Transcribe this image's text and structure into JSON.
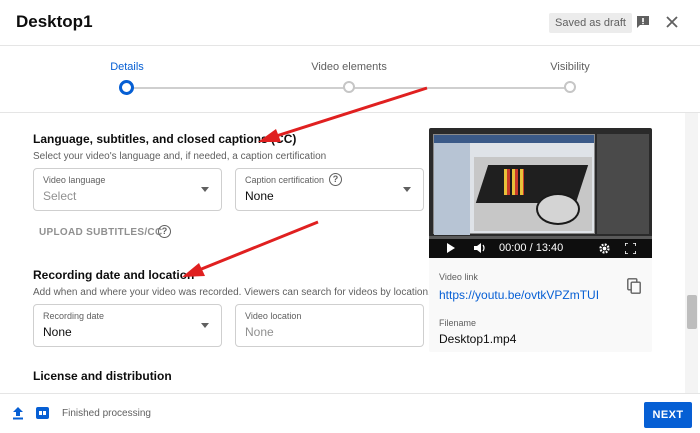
{
  "header": {
    "title": "Desktop1",
    "draft_badge": "Saved as draft"
  },
  "stepper": {
    "steps": [
      {
        "label": "Details",
        "state": "active"
      },
      {
        "label": "Video elements",
        "state": "todo"
      },
      {
        "label": "Visibility",
        "state": "todo"
      }
    ]
  },
  "captions": {
    "title": "Language, subtitles, and closed captions (CC)",
    "description": "Select your video's language and, if needed, a caption certification",
    "video_language_label": "Video language",
    "video_language_value": "Select",
    "caption_cert_label": "Caption certification",
    "caption_cert_value": "None",
    "upload_subtitles": "UPLOAD SUBTITLES/CC"
  },
  "recording": {
    "title": "Recording date and location",
    "description": "Add when and where your video was recorded. Viewers can search for videos by location.",
    "date_label": "Recording date",
    "date_value": "None",
    "location_label": "Video location",
    "location_placeholder": "None"
  },
  "license": {
    "title": "License and distribution"
  },
  "preview": {
    "time": "00:00 / 13:40",
    "video_link_label": "Video link",
    "video_link": "https://youtu.be/ovtkVPZmTUI",
    "filename_label": "Filename",
    "filename": "Desktop1.mp4"
  },
  "footer": {
    "status": "Finished processing",
    "next_label": "NEXT"
  },
  "colors": {
    "accent": "#065fd4",
    "annotation_arrow": "#e02020"
  }
}
